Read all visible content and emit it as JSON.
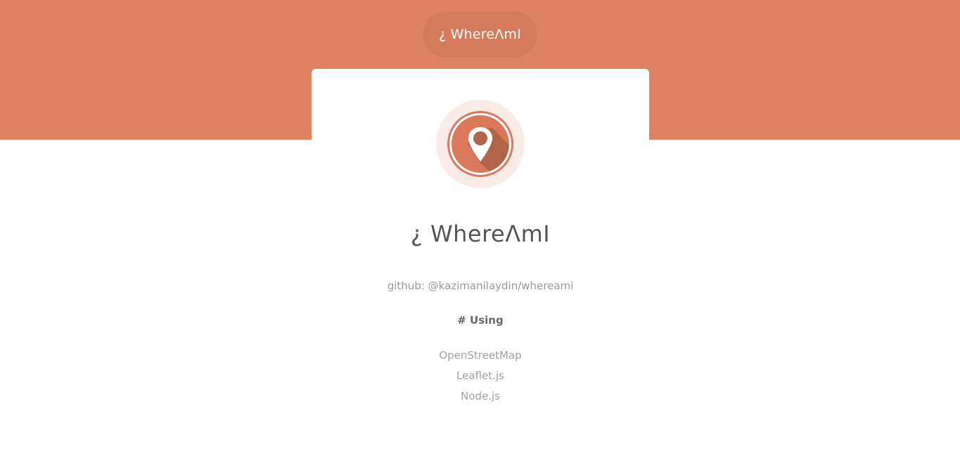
{
  "header": {
    "brand": "¿ WhereΛmI"
  },
  "card": {
    "title": "¿ WhereΛmI",
    "github": "github: @kazimanilaydin/whereami",
    "using_heading": "# Using",
    "technologies": [
      "OpenStreetMap",
      "Leaflet.js",
      "Node.js"
    ],
    "logo_icon": "location-pin-icon"
  },
  "colors": {
    "accent": "#de8262",
    "accent_dark": "#d57a5b",
    "logo_shadow": "#b0654a",
    "logo_halo": "#f9ece7"
  }
}
